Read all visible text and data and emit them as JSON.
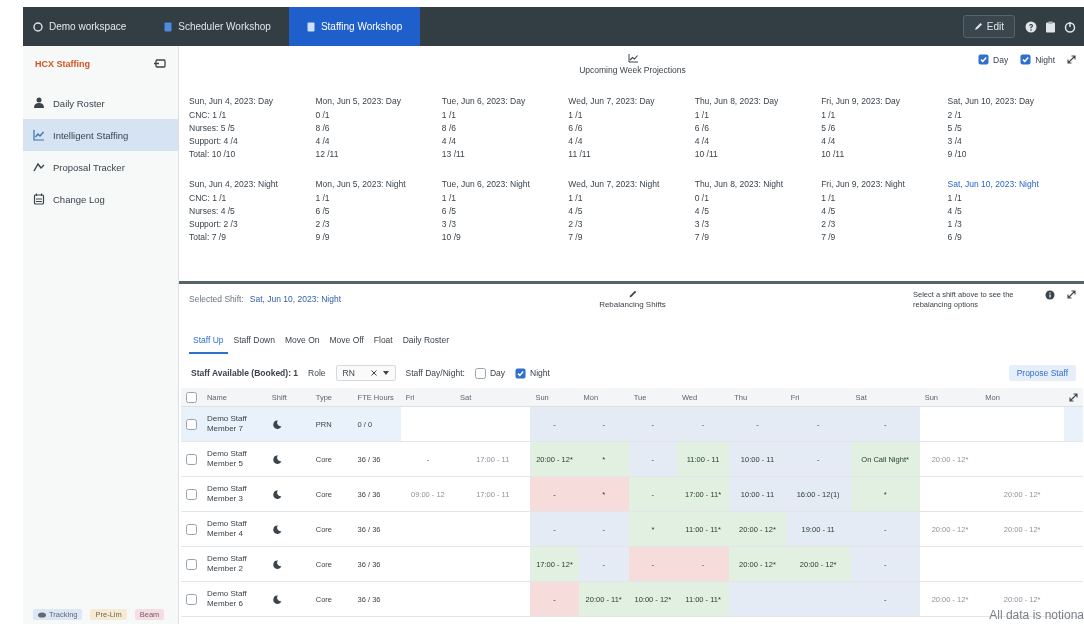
{
  "topbar": {
    "workspace": "Demo workspace",
    "tabs": [
      {
        "label": "Scheduler Workshop",
        "selected": false
      },
      {
        "label": "Staffing Workshop",
        "selected": true
      }
    ],
    "edit_button": "Edit"
  },
  "sidebar": {
    "title": "HCX Staffing",
    "items": [
      {
        "label": "Daily Roster",
        "selected": false
      },
      {
        "label": "Intelligent Staffing",
        "selected": true
      },
      {
        "label": "Proposal Tracker",
        "selected": false
      },
      {
        "label": "Change Log",
        "selected": false
      }
    ],
    "badges": [
      {
        "label": "Tracking",
        "color": "#dbe7f7"
      },
      {
        "label": "Pre-Lim",
        "color": "#f6ead2"
      },
      {
        "label": "Beam",
        "color": "#f6dde3"
      }
    ]
  },
  "projections": {
    "title": "Upcoming Week Projections",
    "toggles": [
      {
        "label": "Day",
        "checked": true
      },
      {
        "label": "Night",
        "checked": true
      }
    ],
    "blocks": [
      {
        "days": [
          {
            "heading": "Sun, Jun 4, 2023: Day",
            "selected": false,
            "lines": [
              "CNC: 1 /1",
              "Nurses: 5 /5",
              "Support: 4 /4",
              "Total: 10 /10"
            ]
          },
          {
            "heading": "Mon, Jun 5, 2023: Day",
            "selected": false,
            "lines": [
              "0 /1",
              "8 /6",
              "4 /4",
              "12 /11"
            ]
          },
          {
            "heading": "Tue, Jun 6, 2023: Day",
            "selected": false,
            "lines": [
              "1 /1",
              "8 /6",
              "4 /4",
              "13 /11"
            ]
          },
          {
            "heading": "Wed, Jun 7, 2023: Day",
            "selected": false,
            "lines": [
              "1 /1",
              "6 /6",
              "4 /4",
              "11 /11"
            ]
          },
          {
            "heading": "Thu, Jun 8, 2023: Day",
            "selected": false,
            "lines": [
              "1 /1",
              "6 /6",
              "4 /4",
              "10 /11"
            ]
          },
          {
            "heading": "Fri, Jun 9, 2023: Day",
            "selected": false,
            "lines": [
              "1 /1",
              "5 /6",
              "4 /4",
              "10 /11"
            ]
          },
          {
            "heading": "Sat, Jun 10, 2023: Day",
            "selected": false,
            "lines": [
              "2 /1",
              "5 /5",
              "3 /4",
              "9 /10"
            ]
          }
        ]
      },
      {
        "days": [
          {
            "heading": "Sun, Jun 4, 2023: Night",
            "selected": false,
            "lines": [
              "CNC: 1 /1",
              "Nurses: 4 /5",
              "Support: 2 /3",
              "Total: 7 /9"
            ]
          },
          {
            "heading": "Mon, Jun 5, 2023: Night",
            "selected": false,
            "lines": [
              "1 /1",
              "6 /5",
              "2 /3",
              "9 /9"
            ]
          },
          {
            "heading": "Tue, Jun 6, 2023: Night",
            "selected": false,
            "lines": [
              "1 /1",
              "6 /5",
              "3 /3",
              "10 /9"
            ]
          },
          {
            "heading": "Wed, Jun 7, 2023: Night",
            "selected": false,
            "lines": [
              "1 /1",
              "4 /5",
              "2 /3",
              "7 /9"
            ]
          },
          {
            "heading": "Thu, Jun 8, 2023: Night",
            "selected": false,
            "lines": [
              "0 /1",
              "4 /5",
              "3 /3",
              "7 /9"
            ]
          },
          {
            "heading": "Fri, Jun 9, 2023: Night",
            "selected": false,
            "lines": [
              "1 /1",
              "4 /5",
              "2 /3",
              "7 /9"
            ]
          },
          {
            "heading": "Sat, Jun 10, 2023: Night",
            "selected": true,
            "lines": [
              "1 /1",
              "4 /5",
              "1 /3",
              "6 /9"
            ]
          }
        ]
      }
    ]
  },
  "rebalancing": {
    "selected_label": "Selected Shift:",
    "selected_value": "Sat, Jun 10, 2023: Night",
    "title": "Rebalancing Shifts",
    "hint": "Select a shift above to see the rebalancing options",
    "tabs": [
      {
        "label": "Staff Up",
        "selected": true
      },
      {
        "label": "Staff Down",
        "selected": false
      },
      {
        "label": "Move On",
        "selected": false
      },
      {
        "label": "Move Off",
        "selected": false
      },
      {
        "label": "Float",
        "selected": false
      },
      {
        "label": "Daily Roster",
        "selected": false
      }
    ],
    "filters": {
      "available": "Staff Available (Booked): 1",
      "role_label": "Role",
      "role_value": "RN",
      "daynight_label": "Staff Day/Night:",
      "options": [
        {
          "label": "Day",
          "checked": false
        },
        {
          "label": "Night",
          "checked": true
        }
      ]
    },
    "propose_button": "Propose Staff",
    "table": {
      "header_checked": false,
      "columns": [
        "Name",
        "Shift",
        "Type",
        "FTE Hours",
        "Fri",
        "Sat",
        "Sun",
        "Mon",
        "Tue",
        "Wed",
        "Thu",
        "Fri",
        "Sat",
        "Sun",
        "Mon"
      ],
      "rows": [
        {
          "checked": false,
          "highlighted": true,
          "cells": [
            {
              "kind": "text",
              "text": "Demo Staff Member 7"
            },
            {
              "kind": "icon"
            },
            {
              "kind": "text",
              "text": "PRN"
            },
            {
              "kind": "text",
              "text": "0 / 0"
            },
            {
              "kind": "day",
              "color": "#ffffff"
            },
            {
              "kind": "day",
              "color": "#ffffff"
            },
            {
              "kind": "day",
              "text": "-",
              "color": "#e5ebf4"
            },
            {
              "kind": "day",
              "text": "-",
              "color": "#e5ebf4"
            },
            {
              "kind": "day",
              "text": "-",
              "color": "#e5ebf4"
            },
            {
              "kind": "day",
              "text": "-",
              "color": "#e5ebf4"
            },
            {
              "kind": "day",
              "text": "-",
              "color": "#e5ebf4"
            },
            {
              "kind": "day",
              "text": "-",
              "color": "#e5ebf4"
            },
            {
              "kind": "day",
              "text": "-",
              "color": "#e5ebf4"
            },
            {
              "kind": "day",
              "color": "#ffffff"
            },
            {
              "kind": "day",
              "color": "#ffffff"
            }
          ]
        },
        {
          "checked": false,
          "highlighted": false,
          "cells": [
            {
              "kind": "text",
              "text": "Demo Staff Member 5"
            },
            {
              "kind": "icon"
            },
            {
              "kind": "text",
              "text": "Core"
            },
            {
              "kind": "text",
              "text": "36 / 36"
            },
            {
              "kind": "day",
              "text": "-",
              "color": "#ffffff"
            },
            {
              "kind": "day",
              "text": "17:00 - 11",
              "disabled": true,
              "color": "#ffffff"
            },
            {
              "kind": "day",
              "text": "20:00 - 12*",
              "disabled": false,
              "color": "#e2f0e2"
            },
            {
              "kind": "day",
              "text": "*",
              "color": "#e2f0e2"
            },
            {
              "kind": "day",
              "text": "-",
              "color": "#e5ebf4"
            },
            {
              "kind": "day",
              "text": "11:00 - 11",
              "disabled": false,
              "color": "#e2f0e2"
            },
            {
              "kind": "day",
              "text": "10:00 - 11",
              "disabled": false,
              "color": "#e5ebf4"
            },
            {
              "kind": "day",
              "text": "-",
              "color": "#e5ebf4"
            },
            {
              "kind": "day",
              "text": "On Call Night*",
              "disabled": false,
              "color": "#e2f0e2"
            },
            {
              "kind": "day",
              "text": "20:00 - 12*",
              "disabled": true,
              "color": "#ffffff"
            },
            {
              "kind": "day",
              "color": "#ffffff"
            }
          ]
        },
        {
          "checked": false,
          "highlighted": false,
          "cells": [
            {
              "kind": "text",
              "text": "Demo Staff Member 3"
            },
            {
              "kind": "icon"
            },
            {
              "kind": "text",
              "text": "Core"
            },
            {
              "kind": "text",
              "text": "36 / 36"
            },
            {
              "kind": "day",
              "text": "09:00 - 12",
              "disabled": true,
              "color": "#ffffff"
            },
            {
              "kind": "day",
              "text": "17:00 - 11",
              "disabled": true,
              "color": "#ffffff"
            },
            {
              "kind": "day",
              "text": "-",
              "color": "#f7dcdc"
            },
            {
              "kind": "day",
              "text": "*",
              "color": "#f7dcdc"
            },
            {
              "kind": "day",
              "text": "-",
              "color": "#e2f0e2"
            },
            {
              "kind": "day",
              "text": "17:00 - 11*",
              "disabled": false,
              "color": "#e2f0e2"
            },
            {
              "kind": "day",
              "text": "10:00 - 11",
              "disabled": false,
              "color": "#e5ebf4"
            },
            {
              "kind": "day",
              "text": "16:00 - 12(1)",
              "disabled": false,
              "color": "#e5ebf4"
            },
            {
              "kind": "day",
              "text": "*",
              "color": "#e2f0e2"
            },
            {
              "kind": "day",
              "color": "#ffffff"
            },
            {
              "kind": "day",
              "text": "20:00 - 12*",
              "disabled": true,
              "color": "#ffffff"
            }
          ]
        },
        {
          "checked": false,
          "highlighted": false,
          "cells": [
            {
              "kind": "text",
              "text": "Demo Staff Member 4"
            },
            {
              "kind": "icon"
            },
            {
              "kind": "text",
              "text": "Core"
            },
            {
              "kind": "text",
              "text": "36 / 36"
            },
            {
              "kind": "day",
              "color": "#ffffff"
            },
            {
              "kind": "day",
              "color": "#ffffff"
            },
            {
              "kind": "day",
              "text": "-",
              "color": "#e5ebf4"
            },
            {
              "kind": "day",
              "text": "-",
              "color": "#e5ebf4"
            },
            {
              "kind": "day",
              "text": "*",
              "color": "#e2f0e2"
            },
            {
              "kind": "day",
              "text": "11:00 - 11*",
              "disabled": false,
              "color": "#e2f0e2"
            },
            {
              "kind": "day",
              "text": "20:00 - 12*",
              "disabled": false,
              "color": "#e2f0e2"
            },
            {
              "kind": "day",
              "text": "19:00 - 11",
              "disabled": false,
              "color": "#e5ebf4"
            },
            {
              "kind": "day",
              "text": "-",
              "color": "#e5ebf4"
            },
            {
              "kind": "day",
              "text": "20:00 - 12*",
              "disabled": true,
              "color": "#ffffff"
            },
            {
              "kind": "day",
              "text": "20:00 - 12*",
              "disabled": true,
              "color": "#ffffff"
            }
          ]
        },
        {
          "checked": false,
          "highlighted": false,
          "cells": [
            {
              "kind": "text",
              "text": "Demo Staff Member 2"
            },
            {
              "kind": "icon"
            },
            {
              "kind": "text",
              "text": "Core"
            },
            {
              "kind": "text",
              "text": "36 / 36"
            },
            {
              "kind": "day",
              "color": "#ffffff"
            },
            {
              "kind": "day",
              "color": "#ffffff"
            },
            {
              "kind": "day",
              "text": "17:00 - 12*",
              "disabled": false,
              "color": "#e2f0e2"
            },
            {
              "kind": "day",
              "text": "-",
              "color": "#e5ebf4"
            },
            {
              "kind": "day",
              "text": "-",
              "color": "#f7dcdc"
            },
            {
              "kind": "day",
              "text": "-",
              "color": "#f7dcdc"
            },
            {
              "kind": "day",
              "text": "20:00 - 12*",
              "disabled": false,
              "color": "#e2f0e2"
            },
            {
              "kind": "day",
              "text": "20:00 - 12*",
              "disabled": false,
              "color": "#e2f0e2"
            },
            {
              "kind": "day",
              "text": "-",
              "color": "#e5ebf4"
            },
            {
              "kind": "day",
              "color": "#ffffff"
            },
            {
              "kind": "day",
              "color": "#ffffff"
            }
          ]
        },
        {
          "checked": false,
          "highlighted": false,
          "cells": [
            {
              "kind": "text",
              "text": "Demo Staff Member 6"
            },
            {
              "kind": "icon"
            },
            {
              "kind": "text",
              "text": "Core"
            },
            {
              "kind": "text",
              "text": "36 / 36"
            },
            {
              "kind": "day",
              "color": "#ffffff"
            },
            {
              "kind": "day",
              "color": "#ffffff"
            },
            {
              "kind": "day",
              "text": "-",
              "color": "#f7dcdc"
            },
            {
              "kind": "day",
              "text": "20:00 - 11*",
              "disabled": false,
              "color": "#e2f0e2"
            },
            {
              "kind": "day",
              "text": "10:00 - 12*",
              "disabled": false,
              "color": "#e2f0e2"
            },
            {
              "kind": "day",
              "text": "11:00 - 11*",
              "disabled": false,
              "color": "#e2f0e2"
            },
            {
              "kind": "day",
              "color": "#e5ebf4"
            },
            {
              "kind": "day",
              "color": "#e5ebf4"
            },
            {
              "kind": "day",
              "text": "-",
              "color": "#e5ebf4"
            },
            {
              "kind": "day",
              "text": "20:00 - 12*",
              "disabled": true,
              "color": "#ffffff"
            },
            {
              "kind": "day",
              "text": "20:00 - 12*",
              "disabled": true,
              "color": "#ffffff"
            }
          ]
        }
      ]
    }
  },
  "note": "All data is notiona"
}
